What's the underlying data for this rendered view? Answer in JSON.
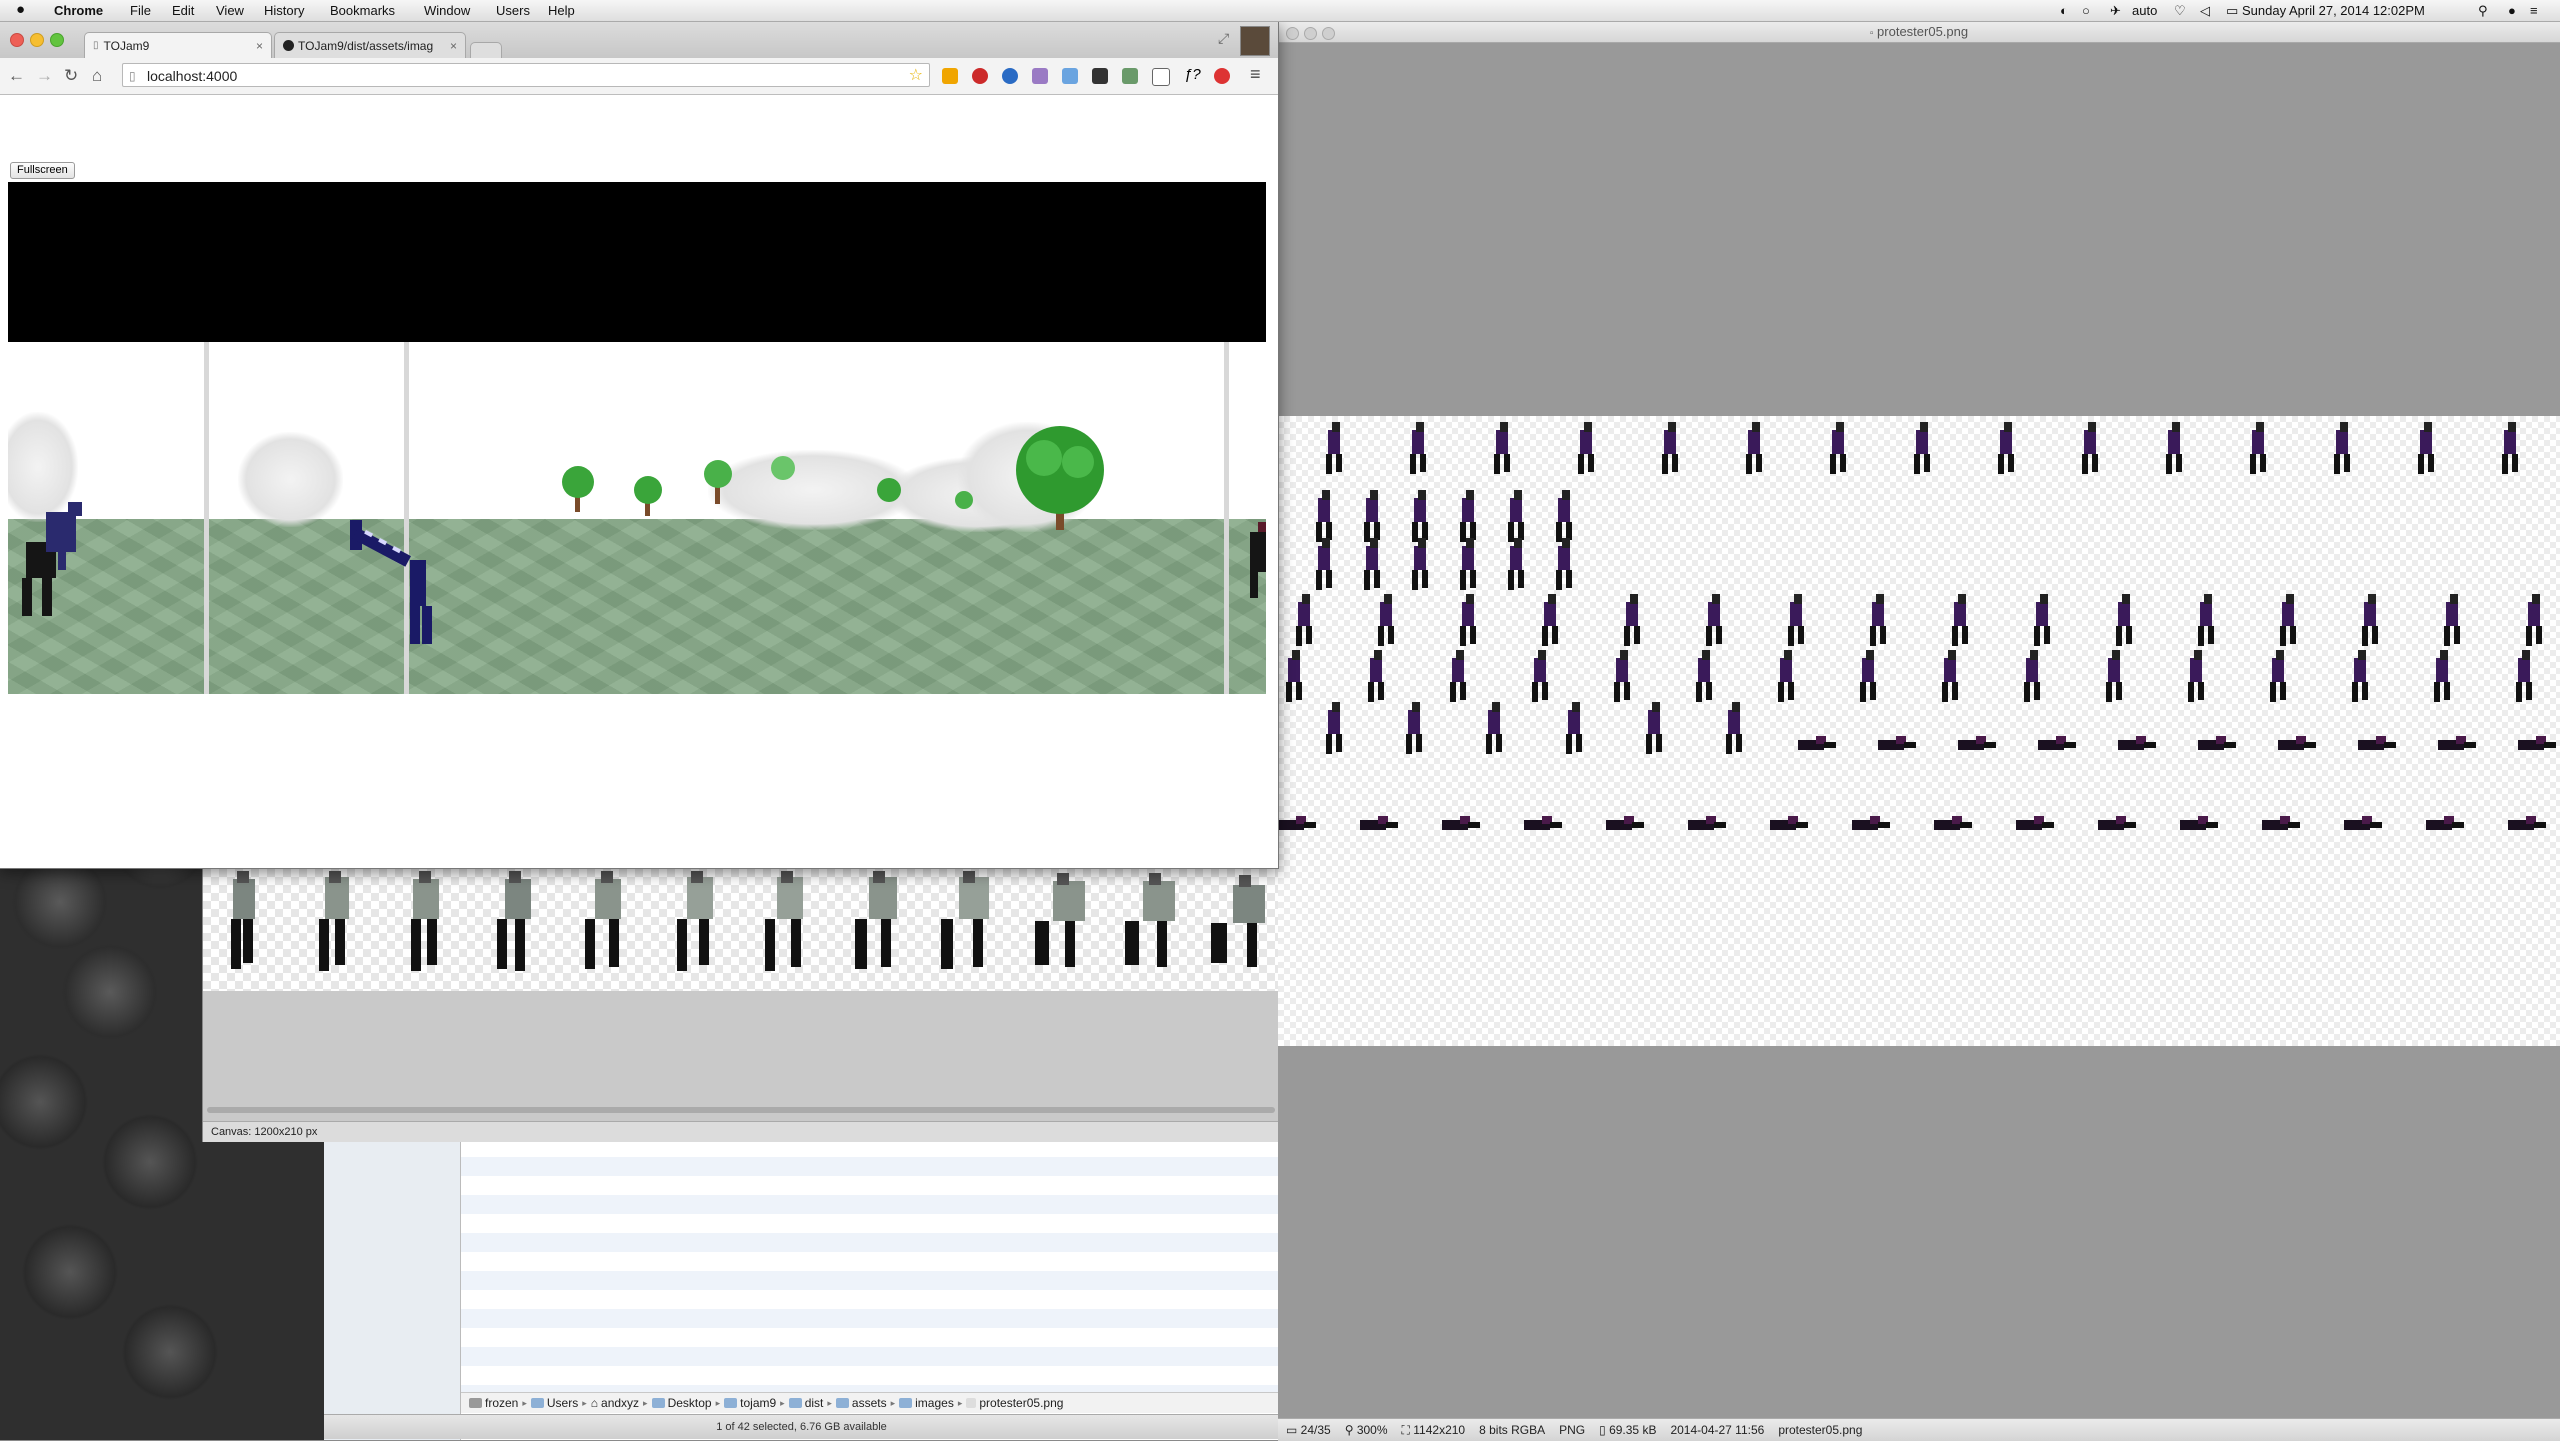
{
  "menubar": {
    "app_name": "Chrome",
    "menus": [
      "File",
      "Edit",
      "View",
      "History",
      "Bookmarks",
      "Window",
      "Users",
      "Help"
    ],
    "status": {
      "input_mode": "auto",
      "datetime": "Sunday April 27, 2014  12:02PM"
    }
  },
  "browser": {
    "tabs": [
      {
        "title": "TOJam9",
        "active": true
      },
      {
        "title": "TOJam9/dist/assets/imag",
        "active": false
      }
    ],
    "address": "localhost:4000",
    "page": {
      "fullscreen_button": "Fullscreen"
    },
    "colors": {
      "sky": "#000000",
      "ground": "#86a987",
      "player": "#1a1a66"
    }
  },
  "editor": {
    "canvas_info": "Canvas: 1200x210 px"
  },
  "finder": {
    "path": [
      "frozen",
      "Users",
      "andxyz",
      "Desktop",
      "tojam9",
      "dist",
      "assets",
      "images",
      "protester05.png"
    ],
    "status": "1 of 42 selected, 6.76 GB available"
  },
  "preview": {
    "title": "protester05.png",
    "status": {
      "page": "24/35",
      "zoom": "300%",
      "dimensions": "1142x210",
      "depth": "8 bits RGBA",
      "format": "PNG",
      "size": "69.35 kB",
      "modified": "2014-04-27 11:56",
      "filename": "protester05.png"
    }
  }
}
